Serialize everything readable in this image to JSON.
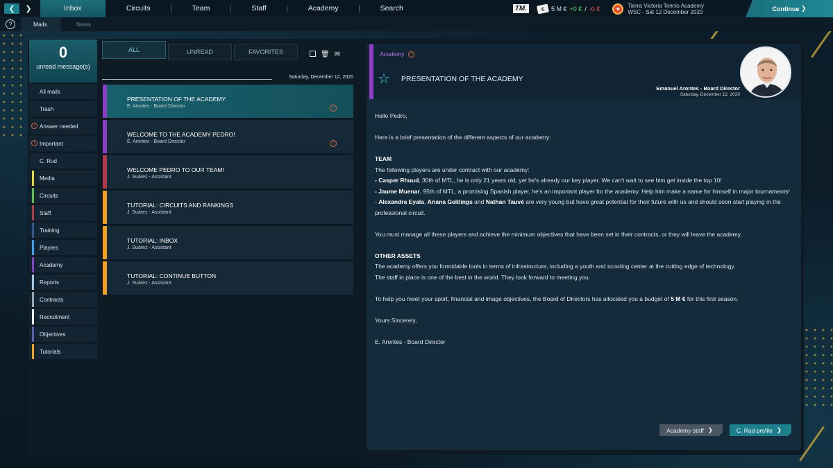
{
  "topbar": {
    "tabs": [
      {
        "label": "Inbox",
        "active": true
      },
      {
        "label": "Circuits",
        "active": false
      },
      {
        "label": "Team",
        "active": false
      },
      {
        "label": "Staff",
        "active": false
      },
      {
        "label": "Academy",
        "active": false
      },
      {
        "label": "Search",
        "active": false
      }
    ],
    "tm_logo": "TM.",
    "budget": "5 M €",
    "income": "+0 €",
    "separator": "/",
    "expense": "-0 €",
    "club_name": "Tierra Victoria Tennis Academy",
    "club_date": "WSC - Sat 12 December 2020",
    "continue_label": "Continue"
  },
  "subbar": {
    "help": "?",
    "tabs": [
      {
        "label": "Mails",
        "active": true
      },
      {
        "label": "News",
        "active": false
      }
    ]
  },
  "sidebar": {
    "unread_count": "0",
    "unread_label": "unread message(s)",
    "items": [
      {
        "label": "All mails",
        "color": "",
        "warn": false
      },
      {
        "label": "Trash",
        "color": "",
        "warn": false
      },
      {
        "label": "Answer needed",
        "color": "",
        "warn": true
      },
      {
        "label": "Important",
        "color": "",
        "warn": true
      },
      {
        "label": "C. Rud",
        "color": "",
        "warn": false
      },
      {
        "label": "Media",
        "color": "#e8d63a",
        "warn": false
      },
      {
        "label": "Circuits",
        "color": "#5bbf4a",
        "warn": false
      },
      {
        "label": "Staff",
        "color": "#b03a48",
        "warn": false
      },
      {
        "label": "Training",
        "color": "#2a5a8a",
        "warn": false
      },
      {
        "label": "Players",
        "color": "#3aa0e8",
        "warn": false
      },
      {
        "label": "Academy",
        "color": "#8a3fc4",
        "warn": false
      },
      {
        "label": "Reports",
        "color": "#9ec8e0",
        "warn": false
      },
      {
        "label": "Contracts",
        "color": "#9aa4ac",
        "warn": false
      },
      {
        "label": "Recruitment",
        "color": "#f2f2f2",
        "warn": false
      },
      {
        "label": "Objectives",
        "color": "#5a5fb0",
        "warn": false
      },
      {
        "label": "Tutorials",
        "color": "#f0a020",
        "warn": false
      }
    ]
  },
  "filters": {
    "tabs": [
      {
        "label": "ALL",
        "active": true
      },
      {
        "label": "UNREAD",
        "active": false
      },
      {
        "label": "FAVORITES",
        "active": false
      }
    ]
  },
  "list": {
    "date": "Saturday, December 12, 2020",
    "mails": [
      {
        "subject": "PRESENTATION OF THE ACADEMY",
        "from": "E. Arontes - Board Director",
        "color": "#8a3fc4",
        "warn": true,
        "selected": true
      },
      {
        "subject": "WELCOME TO THE ACADEMY PEDRO!",
        "from": "E. Arontes - Board Director",
        "color": "#8a3fc4",
        "warn": true,
        "selected": false
      },
      {
        "subject": "WELCOME PEDRO TO OUR TEAM!",
        "from": "J. Suárez - Assistant",
        "color": "#b03a48",
        "warn": false,
        "selected": false
      },
      {
        "subject": "TUTORIAL: CIRCUITS AND RANKINGS",
        "from": "J. Suárez - Assistant",
        "color": "#f0a020",
        "warn": false,
        "selected": false
      },
      {
        "subject": "TUTORIAL: INBOX",
        "from": "J. Suárez - Assistant",
        "color": "#f0a020",
        "warn": false,
        "selected": false
      },
      {
        "subject": "TUTORIAL: CONTINUE BUTTON",
        "from": "J. Suárez - Assistant",
        "color": "#f0a020",
        "warn": false,
        "selected": false
      }
    ]
  },
  "mail": {
    "category": "Academy",
    "title": "PRESENTATION OF THE ACADEMY",
    "sender": "Emanuel Arontes - Board Director",
    "date": "Saturday, December 12, 2020",
    "greeting": "Hello Pedro,",
    "intro": "Here is a brief presentation of the different aspects of our academy:",
    "team_heading": "TEAM",
    "team_line": " The following players are under contract with our academy:",
    "p1_name": "- Casper Rhuud",
    "p1_text": ", 30th of MTL, he is only 21 years old, yet he's already our key player. We can't wait to see him get inside the top 10!",
    "p2_name": "- Jaume Muenar",
    "p2_text": ", 95th of MTL, a promising Spanish player, he's an important player for the academy. Help him make a name for himself in major tournaments!",
    "p3_prefix": " - ",
    "p3_name1": "Alexandra Eyala",
    "p3_sep1": ", ",
    "p3_name2": "Ariana Geitlings",
    "p3_sep2": " and ",
    "p3_name3": "Nathan Tauvé",
    "p3_text": " are very young but have great potential for their future with us and should soon start playing in the professional circuit.",
    "manage": " You must manage all these players and achieve the minimum objectives that have been set in their contracts, or they will leave the academy.",
    "assets_heading": "OTHER ASSETS",
    "assets1": " The academy offers you formidable tools in terms of infrastructure, including a youth and scouting center at the cutting edge of technology.",
    "assets2": " The staff in place is one of the best in the world. They look forward to meeting you.",
    "budget_pre": "To help you meet your sport, financial and image objectives, the Board of Directors has allocated you a budget of ",
    "budget_amount": "5 M €",
    "budget_post": " for this first season.",
    "closing": "Yours Sincerely,",
    "signature": "E. Arontes - Board Director",
    "btn_staff": "Academy staff",
    "btn_profile": "C. Rud profile"
  }
}
